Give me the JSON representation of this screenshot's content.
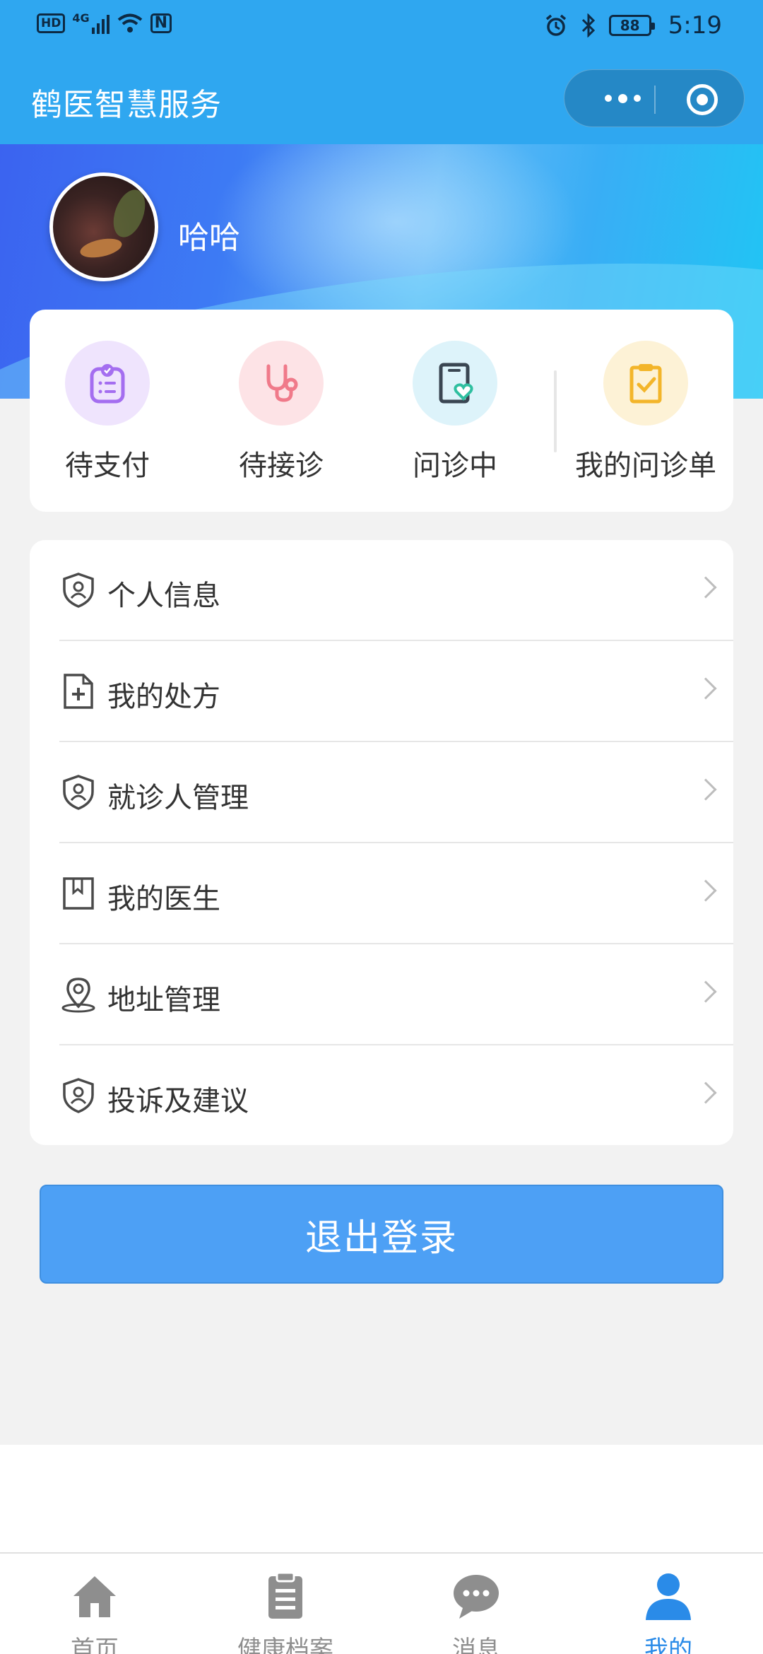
{
  "status_bar": {
    "hd": "HD",
    "net": "4G",
    "nfc": "N",
    "battery": "88",
    "time": "5:19"
  },
  "nav": {
    "title": "鹤医智慧服务"
  },
  "profile": {
    "username": "哈哈"
  },
  "quick_actions": [
    {
      "label": "待支付",
      "icon": "payment-list-icon",
      "color": "#a46ef0",
      "bg": "#efe4fd"
    },
    {
      "label": "待接诊",
      "icon": "stethoscope-icon",
      "color": "#f07a8a",
      "bg": "#fde3e6"
    },
    {
      "label": "问诊中",
      "icon": "tablet-heart-icon",
      "color": "#2fbfa0",
      "bg": "#ddf3fa"
    },
    {
      "label": "我的问诊单",
      "icon": "clipboard-check-icon",
      "color": "#f3b52a",
      "bg": "#fdf2d6"
    }
  ],
  "menu": [
    {
      "label": "个人信息",
      "icon": "user-shield-icon"
    },
    {
      "label": "我的处方",
      "icon": "file-plus-icon"
    },
    {
      "label": "就诊人管理",
      "icon": "user-shield-icon"
    },
    {
      "label": "我的医生",
      "icon": "bookmark-icon"
    },
    {
      "label": "地址管理",
      "icon": "location-pin-icon"
    },
    {
      "label": "投诉及建议",
      "icon": "user-shield-icon"
    }
  ],
  "logout": {
    "label": "退出登录"
  },
  "tabs": [
    {
      "label": "首页",
      "icon": "home-icon",
      "active": false
    },
    {
      "label": "健康档案",
      "icon": "clipboard-icon",
      "active": false
    },
    {
      "label": "消息",
      "icon": "chat-bubble-icon",
      "active": false
    },
    {
      "label": "我的",
      "icon": "person-icon",
      "active": true
    }
  ],
  "colors": {
    "nav_bg": "#2fa7f0",
    "accent": "#2a8be8",
    "logout_bg": "#4da0f5"
  }
}
